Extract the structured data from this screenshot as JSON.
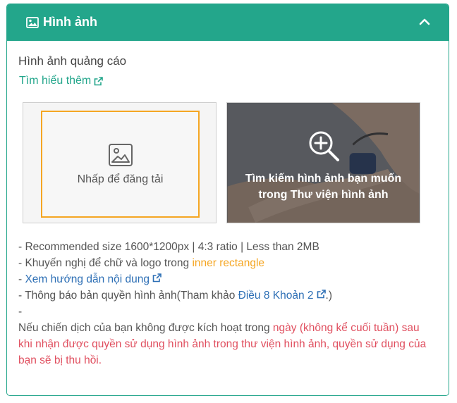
{
  "panel": {
    "title": "Hình ảnh",
    "colors": {
      "accent": "#23a68b",
      "orange": "#f5a623",
      "red": "#e04f5f",
      "link_blue": "#2d6fb5"
    }
  },
  "section": {
    "label": "Hình ảnh quảng cáo",
    "learn_more": "Tìm hiểu thêm"
  },
  "upload": {
    "label": "Nhấp để đăng tải"
  },
  "library": {
    "line1": "Tìm kiếm hình ảnh bạn muốn",
    "line2": "trong Thư viện hình ảnh"
  },
  "notes": {
    "line1": "- Recommended size 1600*1200px | 4:3 ratio | Less than 2MB",
    "line2_prefix": "- Khuyến nghị để chữ và logo trong ",
    "line2_highlight": "inner rectangle",
    "line3_prefix": "- ",
    "line3_link": "Xem hướng dẫn nội dung",
    "line4_prefix": "- Thông báo bản quyền hình ảnh(Tham khảo ",
    "line4_link": "Điều 8 Khoản 2",
    "line4_suffix": ".)",
    "line5": "-",
    "notice_plain": "Nếu chiến dịch của bạn không được kích hoạt trong ",
    "notice_red": "ngày (không kể cuối tuần) sau khi nhận được quyền sử dụng hình ảnh trong thư viện hình ảnh, quyền sử dụng của bạn sẽ bị thu hồi."
  },
  "icons": {
    "header": "image-icon",
    "collapse": "chevron-up-icon",
    "external": "external-link-icon",
    "upload": "image-placeholder-icon",
    "library": "zoom-in-icon"
  }
}
